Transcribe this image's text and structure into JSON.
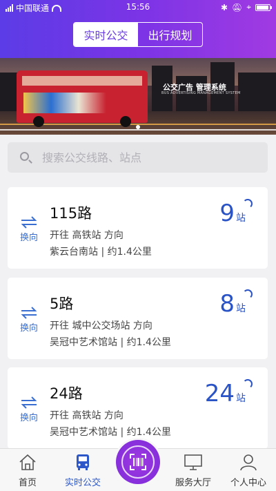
{
  "status": {
    "carrier": "中国联通",
    "time": "15:56"
  },
  "tabs_top": {
    "realtime": "实时公交",
    "plan": "出行规划"
  },
  "banner": {
    "title": "公交广告 管理系统",
    "subtitle": "BUS ADVERTISING MANAGEMENT SYSTEM"
  },
  "search": {
    "placeholder": "搜索公交线路、站点"
  },
  "cards": [
    {
      "route": "115路",
      "direction": "开往 高铁站 方向",
      "stop": "紫云台南站 | 约1.4公里",
      "count": "9",
      "unit": "站",
      "swap": "换向"
    },
    {
      "route": "5路",
      "direction": "开往 城中公交场站 方向",
      "stop": "吴冠中艺术馆站 | 约1.4公里",
      "count": "8",
      "unit": "站",
      "swap": "换向"
    },
    {
      "route": "24路",
      "direction": "开往 高铁站 方向",
      "stop": "吴冠中艺术馆站 | 约1.4公里",
      "count": "24",
      "unit": "站",
      "swap": "换向"
    }
  ],
  "nav": [
    {
      "label": "首页",
      "icon": "home-icon"
    },
    {
      "label": "实时公交",
      "icon": "bus-icon"
    },
    {
      "label": "",
      "icon": "scan-icon"
    },
    {
      "label": "服务大厅",
      "icon": "monitor-icon"
    },
    {
      "label": "个人中心",
      "icon": "user-icon"
    }
  ],
  "colors": {
    "accent": "#2b57c8",
    "header_start": "#5b3ce6",
    "header_end": "#a13ae2"
  }
}
